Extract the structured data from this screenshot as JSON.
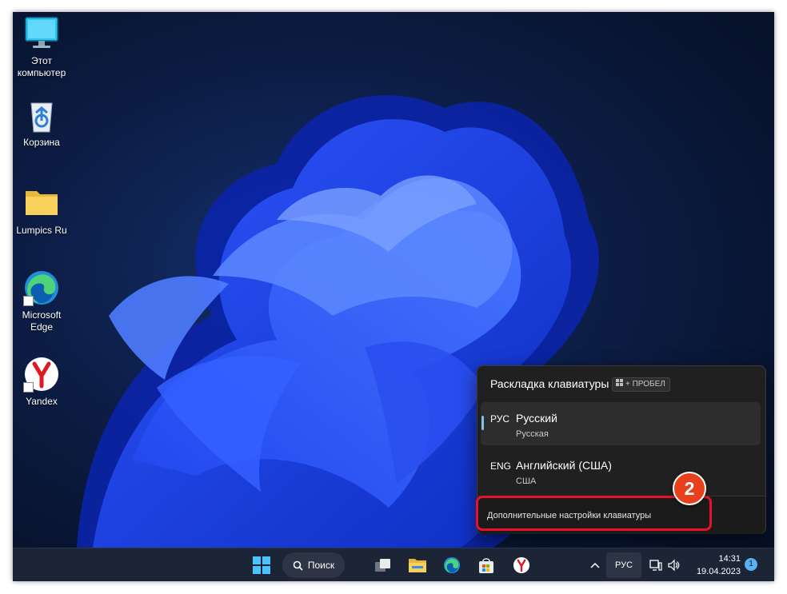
{
  "desktop": {
    "icons": [
      {
        "label": "Этот компьютер",
        "icon": "monitor-icon"
      },
      {
        "label": "Корзина",
        "icon": "recycle-bin-icon"
      },
      {
        "label": "Lumpics Ru",
        "icon": "folder-icon"
      },
      {
        "label": "Microsoft Edge",
        "icon": "edge-icon"
      },
      {
        "label": "Yandex",
        "icon": "yandex-icon"
      }
    ]
  },
  "flyout": {
    "title": "Раскладка клавиатуры",
    "hotkey": "+ ПРОБЕЛ",
    "languages": [
      {
        "code": "РУС",
        "name": "Русский",
        "layout": "Русская",
        "selected": true
      },
      {
        "code": "ENG",
        "name": "Английский (США)",
        "layout": "США",
        "selected": false
      }
    ],
    "more_settings": "Дополнительные настройки клавиатуры"
  },
  "annotation": {
    "step": "2",
    "color": "#e8112d"
  },
  "taskbar": {
    "search_label": "Поиск",
    "language": "РУС",
    "time": "14:31",
    "date": "19.04.2023",
    "notifications": "1"
  },
  "colors": {
    "accent": "#7cc2f0",
    "taskbar": "#1c2536",
    "flyout": "#202020"
  }
}
